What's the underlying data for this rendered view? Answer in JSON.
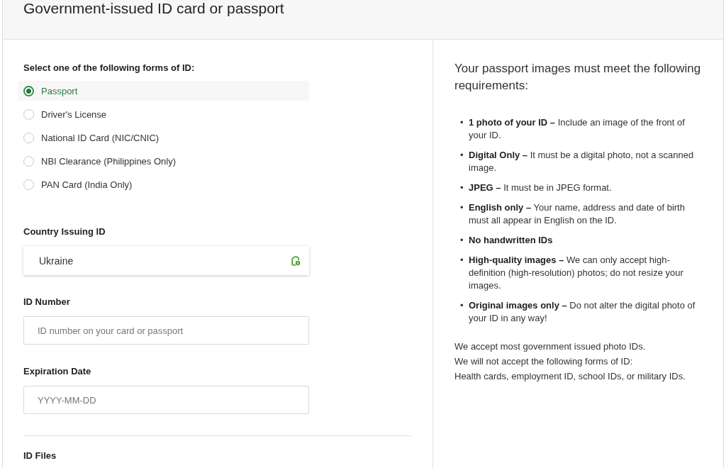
{
  "header": {
    "title": "Government-issued ID card or passport"
  },
  "id_form": {
    "prompt": "Select one of the following forms of ID:",
    "id_types": [
      {
        "label": "Passport",
        "selected": true
      },
      {
        "label": "Driver's License",
        "selected": false
      },
      {
        "label": "National ID Card (NIC/CNIC)",
        "selected": false
      },
      {
        "label": "NBI Clearance (Philippines Only)",
        "selected": false
      },
      {
        "label": "PAN Card (India Only)",
        "selected": false
      }
    ],
    "country": {
      "label": "Country Issuing ID",
      "value": "Ukraine"
    },
    "id_number": {
      "label": "ID Number",
      "placeholder": "ID number on your card or passport"
    },
    "expiration_date": {
      "label": "Expiration Date",
      "placeholder": "YYYY-MM-DD"
    },
    "files": {
      "label": "ID Files"
    }
  },
  "requirements": {
    "heading": "Your passport images must meet the following requirements:",
    "items": [
      {
        "bullet": "•",
        "title": "1 photo of your ID –",
        "text": "Include an image of the front of your ID."
      },
      {
        "bullet": "•",
        "title": "Digital Only –",
        "text": "It must be a digital photo, not a scanned image."
      },
      {
        "bullet": "•",
        "title": "JPEG –",
        "text": "It must be in JPEG format."
      },
      {
        "bullet": "•",
        "title": "English only –",
        "text": "Your name, address and date of birth must all appear in English on the ID."
      },
      {
        "bullet": "•",
        "title": "No handwritten IDs"
      },
      {
        "bullet": "•",
        "title": "High-quality images –",
        "text": "We can only accept high-definition (high-resolution) photos; do not resize your images."
      },
      {
        "bullet": "•",
        "title": "Original images only –",
        "text": "Do not alter the digital photo of your ID in any way!"
      }
    ],
    "notes": [
      "We accept most government issued photo IDs.",
      "We will not accept the following forms of ID:",
      "Health cards, employment ID, school IDs, or military IDs."
    ]
  }
}
